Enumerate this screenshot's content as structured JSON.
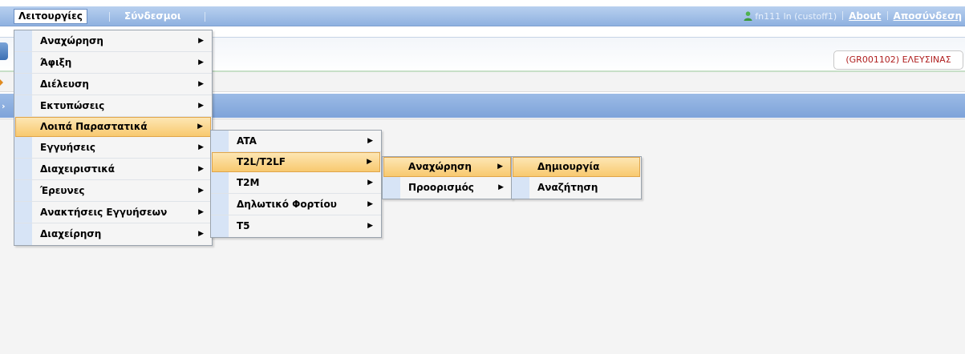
{
  "menubar": {
    "items": [
      {
        "label": "Λειτουργίες"
      },
      {
        "label": "Σύνδεσμοι"
      }
    ],
    "user_text": "fn111 ln (custoff1)",
    "about_label": "About",
    "logout_label": "Αποσύνδεση"
  },
  "customs_office": "(GR001102) ΕΛΕΥΣΙΝΑΣ",
  "menus": {
    "main": [
      {
        "label": "Αναχώρηση"
      },
      {
        "label": "Άφιξη"
      },
      {
        "label": "Διέλευση"
      },
      {
        "label": "Εκτυπώσεις"
      },
      {
        "label": "Λοιπά Παραστατικά"
      },
      {
        "label": "Εγγυήσεις"
      },
      {
        "label": "Διαχειριστικά"
      },
      {
        "label": "Έρευνες"
      },
      {
        "label": "Ανακτήσεις Εγγυήσεων"
      },
      {
        "label": "Διαχείρηση"
      }
    ],
    "other_docs": [
      {
        "label": "ATA"
      },
      {
        "label": "T2L/T2LF"
      },
      {
        "label": "T2M"
      },
      {
        "label": "Δηλωτικό Φορτίου"
      },
      {
        "label": "T5"
      }
    ],
    "t2l": [
      {
        "label": "Αναχώρηση"
      },
      {
        "label": "Προορισμός"
      }
    ],
    "departure": [
      {
        "label": "Δημιουργία"
      },
      {
        "label": "Αναζήτηση"
      }
    ]
  },
  "colors": {
    "menubar": "#8fb1e0",
    "highlight": "#f8c96f",
    "office_text": "#b02020"
  }
}
